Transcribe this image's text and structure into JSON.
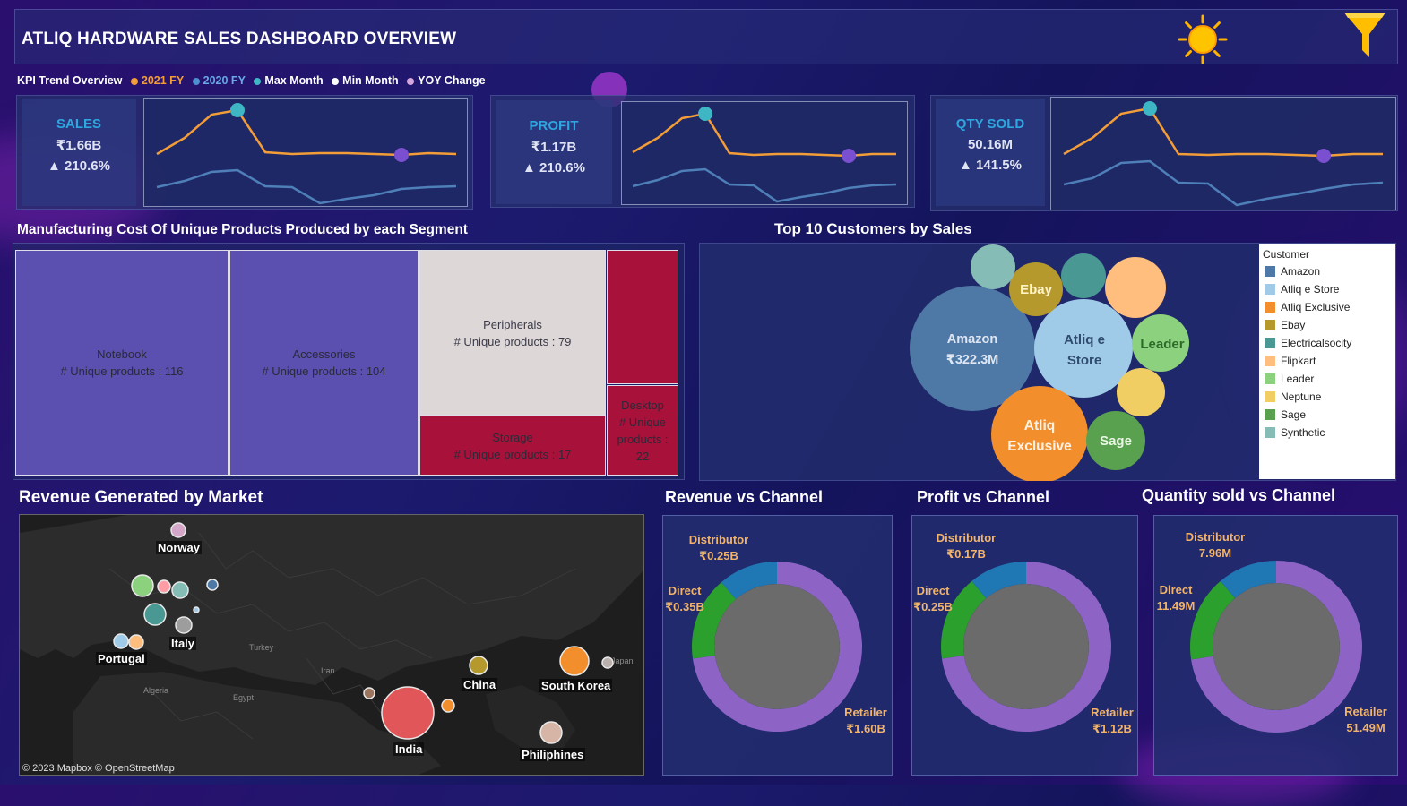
{
  "header": {
    "title": "ATLIQ HARDWARE SALES DASHBOARD OVERVIEW",
    "theme_icon": "sun-icon",
    "filter_icon": "funnel-filter-icon"
  },
  "trend_legend": {
    "title": "KPI Trend Overview",
    "items": [
      {
        "label": "2021 FY",
        "color": "#f29d38"
      },
      {
        "label": "2020 FY",
        "color": "#4e8fd0"
      },
      {
        "label": "Max Month",
        "color": "#3fb6c4"
      },
      {
        "label": "Min Month",
        "color": "#7a4fd0"
      },
      {
        "label": "YOY Change",
        "color": "#b868c8"
      }
    ]
  },
  "kpis": [
    {
      "label": "SALES",
      "value": "₹1.66B",
      "change": "▲ 210.6%"
    },
    {
      "label": "PROFIT",
      "value": "₹1.17B",
      "change": "▲ 210.6%"
    },
    {
      "label": "QTY SOLD",
      "value": "50.16M",
      "change": "▲ 141.5%"
    }
  ],
  "manufacturing": {
    "title": "Manufacturing Cost  Of Unique Products Produced by each Segment",
    "cells": [
      {
        "name": "Notebook",
        "line": "# Unique products : 116",
        "color": "#5b4fb0"
      },
      {
        "name": "Accessories",
        "line": "# Unique products : 104",
        "color": "#5b4fb0"
      },
      {
        "name": "Peripherals",
        "line": "# Unique products : 79",
        "color": "#ded7d8"
      },
      {
        "name": "Storage",
        "line": "# Unique products : 17",
        "color": "#a8123a"
      },
      {
        "name": "Desktop",
        "line": "# Unique products : 22",
        "color": "#a8123a"
      }
    ]
  },
  "customers": {
    "title": "Top 10 Customers by Sales",
    "legend_title": "Customer",
    "legend": [
      {
        "name": "Amazon",
        "color": "#4e79a7"
      },
      {
        "name": "Atliq e Store",
        "color": "#a0cbe8"
      },
      {
        "name": "Atliq Exclusive",
        "color": "#f28e2b"
      },
      {
        "name": "Ebay",
        "color": "#b6992d"
      },
      {
        "name": "Electricalsocity",
        "color": "#499894"
      },
      {
        "name": "Flipkart",
        "color": "#ffbe7d"
      },
      {
        "name": "Leader",
        "color": "#8cd17d"
      },
      {
        "name": "Neptune",
        "color": "#f1ce63"
      },
      {
        "name": "Sage",
        "color": "#59a14f"
      },
      {
        "name": "Synthetic",
        "color": "#86bcb6"
      }
    ],
    "bubble_labels": {
      "amazon_name": "Amazon",
      "amazon_value": "₹322.3M",
      "estore_1": "Atliq e",
      "estore_2": "Store",
      "excl_1": "Atliq",
      "excl_2": "Exclusive",
      "ebay": "Ebay",
      "leader": "Leader",
      "sage": "Sage"
    }
  },
  "market": {
    "title": "Revenue Generated by Market",
    "attribution": "© 2023 Mapbox  © OpenStreetMap",
    "cities": [
      "Norway",
      "Italy",
      "Portugal",
      "China",
      "South Korea",
      "India",
      "Philiphines"
    ],
    "basemap_labels": [
      "Turkey",
      "Iran",
      "Algeria",
      "Egypt",
      "Japan"
    ]
  },
  "channels": [
    {
      "title": "Revenue vs Channel",
      "distributor": "Distributor",
      "distributor_value": "₹0.25B",
      "direct": "Direct",
      "direct_value": "₹0.35B",
      "retailer": "Retailer",
      "retailer_value": "₹1.60B"
    },
    {
      "title": "Profit vs Channel",
      "distributor": "Distributor",
      "distributor_value": "₹0.17B",
      "direct": "Direct",
      "direct_value": "₹0.25B",
      "retailer": "Retailer",
      "retailer_value": "₹1.12B"
    },
    {
      "title": "Quantity sold  vs Channel",
      "distributor": "Distributor",
      "distributor_value": "7.96M",
      "direct": "Direct",
      "direct_value": "11.49M",
      "retailer": "Retailer",
      "retailer_value": "51.49M"
    }
  ],
  "channel_colors": {
    "retailer": "#8e63c6",
    "direct": "#2ca02c",
    "distributor": "#1f77b4",
    "hole": "#6b6b6b"
  }
}
